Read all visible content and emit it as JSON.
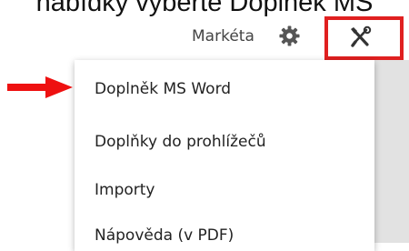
{
  "caption": {
    "text": "nabídky vyberte Doplněk MS"
  },
  "header": {
    "user_name": "Markéta",
    "settings_icon": "gear-icon",
    "tools_icon": "tools-icon"
  },
  "menu": {
    "items": [
      {
        "label": "Doplněk MS Word"
      },
      {
        "label": "Doplňky do prohlížečů"
      },
      {
        "label": "Importy"
      },
      {
        "label": "Nápověda (v PDF)"
      }
    ]
  },
  "colors": {
    "highlight": "#e02020",
    "gear": "#555555",
    "tools": "#333333"
  }
}
